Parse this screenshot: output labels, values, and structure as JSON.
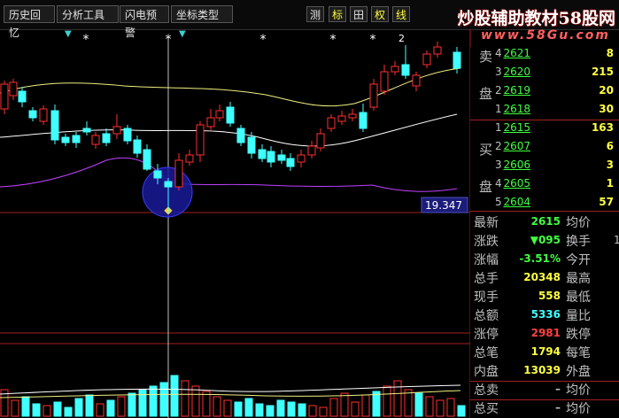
{
  "toolbar": {
    "history": "历史回忆",
    "analysis": "分析工具",
    "alert": "闪电预警",
    "coord": "坐标类型",
    "arrow": "▼",
    "test": "测",
    "mark": "标",
    "grid": "田",
    "weight": "权",
    "line": "线"
  },
  "watermark": {
    "title": "炒股辅助教材58股网",
    "url": "www.58Gu.com"
  },
  "chart": {
    "price_label": "19.347",
    "top_price_label": "2",
    "star_glyph": "*",
    "diamond_glyph": "◆",
    "colors": {
      "up": "#ff3030",
      "down": "#40ffff",
      "upper_band": "#f0f080",
      "mid_band": "#ffffff",
      "lower_band": "#c040ff",
      "volume_line": "#ffffff",
      "cursor": "#c0c0c0",
      "circle": "#1a1a9a"
    }
  },
  "orderbook": {
    "sell_label": "卖",
    "buy_label": "买",
    "disk_label": "盘",
    "sell": [
      {
        "level": "4",
        "price": "2621",
        "vol": "8"
      },
      {
        "level": "3",
        "price": "2620",
        "vol": "215"
      },
      {
        "level": "2",
        "price": "2619",
        "vol": "20"
      },
      {
        "level": "1",
        "price": "2618",
        "vol": "30"
      }
    ],
    "buy": [
      {
        "level": "1",
        "price": "2615",
        "vol": "163"
      },
      {
        "level": "2",
        "price": "2607",
        "vol": "6"
      },
      {
        "level": "3",
        "price": "2606",
        "vol": "3"
      },
      {
        "level": "4",
        "price": "2605",
        "vol": "1"
      },
      {
        "level": "5",
        "price": "2604",
        "vol": "57"
      }
    ]
  },
  "stats": [
    {
      "label": "最新",
      "value": "2615",
      "color": "#40ff40",
      "label2": "均价",
      "value2": ""
    },
    {
      "label": "涨跌",
      "value": "▼095",
      "color": "#40ff40",
      "label2": "换手",
      "value2": "1"
    },
    {
      "label": "涨幅",
      "value": "-3.51%",
      "color": "#40ff40",
      "label2": "今开",
      "value2": ""
    },
    {
      "label": "总手",
      "value": "20348",
      "color": "#ffff40",
      "label2": "最高",
      "value2": ""
    },
    {
      "label": "现手",
      "value": "558",
      "color": "#ffff40",
      "label2": "最低",
      "value2": ""
    },
    {
      "label": "总额",
      "value": "5336",
      "color": "#40ffff",
      "label2": "量比",
      "value2": ""
    },
    {
      "label": "涨停",
      "value": "2981",
      "color": "#ff4040",
      "label2": "跌停",
      "value2": ""
    },
    {
      "label": "总笔",
      "value": "1794",
      "color": "#ffff40",
      "label2": "每笔",
      "value2": ""
    },
    {
      "label": "内盘",
      "value": "13039",
      "color": "#ffff40",
      "label2": "外盘",
      "value2": ""
    },
    {
      "label": "总卖",
      "value": "–",
      "color": "#c0c0c0",
      "label2": "均价",
      "value2": ""
    },
    {
      "label": "总买",
      "value": "–",
      "color": "#c0c0c0",
      "label2": "均价",
      "value2": ""
    }
  ]
}
